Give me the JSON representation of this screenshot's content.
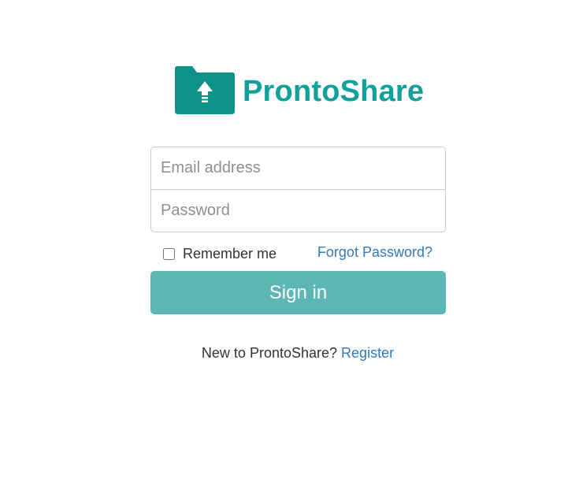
{
  "brand": {
    "name": "ProntoShare",
    "color": "#12a09a",
    "icon": "folder-upload-icon"
  },
  "login_form": {
    "email_placeholder": "Email address",
    "email_value": "",
    "password_placeholder": "Password",
    "password_value": "",
    "remember_label": "Remember me",
    "remember_checked": false,
    "forgot_label": "Forgot Password?",
    "signin_label": "Sign in",
    "signin_color": "#5cb6b3",
    "link_color": "#337ab7"
  },
  "footer": {
    "prompt": "New to ProntoShare?",
    "register_label": "Register"
  }
}
